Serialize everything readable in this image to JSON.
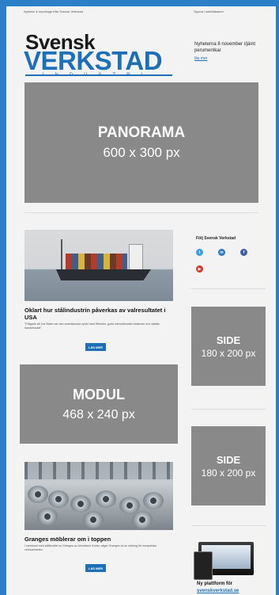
{
  "header": {
    "left_note": "Nyheter & reportage från Svensk Verkstad",
    "right_note": "Öppna i webbläsaren",
    "logo_top": "Svensk",
    "logo_main": "VERKSTAD",
    "logo_sub": "INDUSTRI"
  },
  "newsbox": {
    "title": "Nyheterna 8 november i/jämt perumentkar",
    "link": "läs mer"
  },
  "ads": {
    "panorama": {
      "title": "PANORAMA",
      "size": "600 x 300 px"
    },
    "modul": {
      "title": "MODUL",
      "size": "468 x 240 px"
    },
    "side1": {
      "title": "SIDE",
      "size": "180 x 200 px"
    },
    "side2": {
      "title": "SIDE",
      "size": "180 x 200 px"
    }
  },
  "social": {
    "title": "Följ Svensk Verkstad",
    "colors": {
      "twitter": "#3aa1e8",
      "linkedin": "#2a79c7",
      "facebook": "#3b5fa8",
      "youtube": "#d23a2e"
    }
  },
  "articles": [
    {
      "title": "Oklart hur stålindustrin påverkas av valresultatet i USA",
      "text": "\"Frågade att Joe Biden var den amerikanska nyhet med Wheeler, goda internationella relationer och stabila handelsavtal\"",
      "button": "LÄS MER"
    },
    {
      "title": "Granges möblerar om i toppen",
      "text": "I samband med skiftbrottet av Gränges av Aluminium Konto, säger Granges vd av ordning för europeiska verksamheten.",
      "button": "LÄS MER"
    }
  ],
  "platform": {
    "caption": "Ny plattform för",
    "link": "svenskverkstad.se"
  }
}
